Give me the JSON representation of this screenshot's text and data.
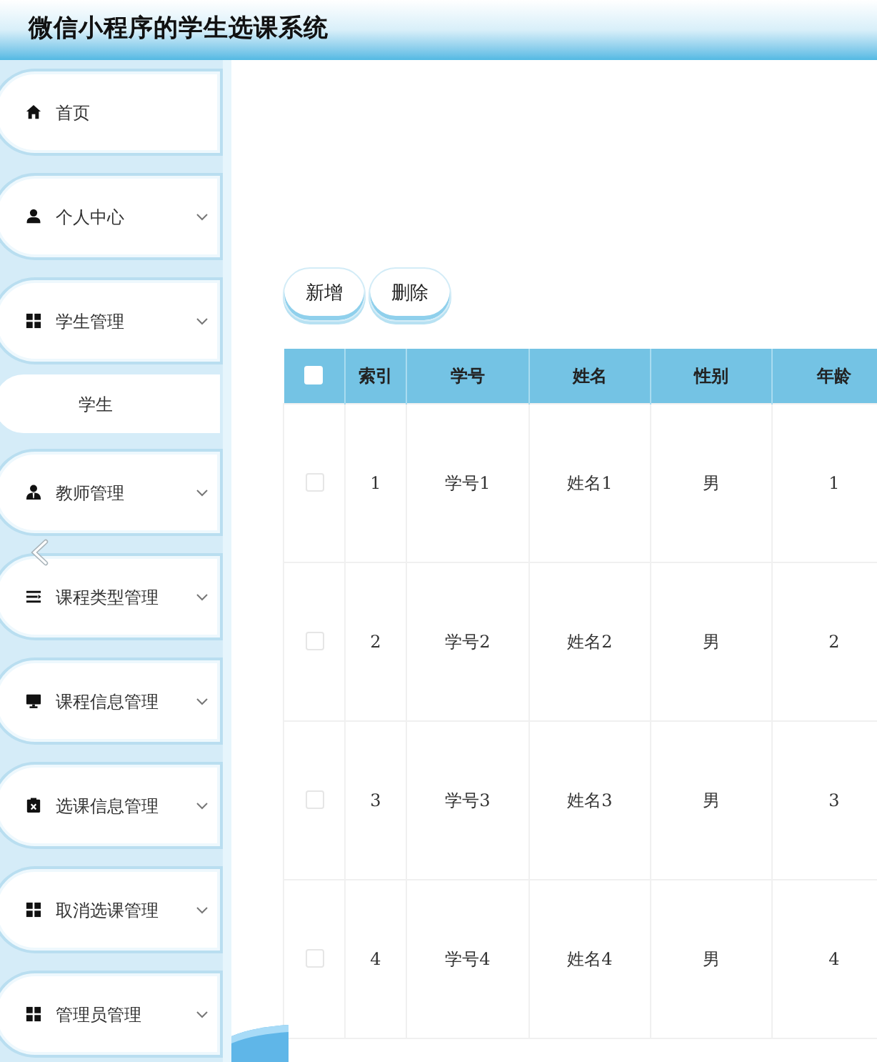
{
  "header": {
    "title": "微信小程序的学生选课系统"
  },
  "sidebar": {
    "items": [
      {
        "label": "首页",
        "kind": "link"
      },
      {
        "label": "个人中心",
        "kind": "group"
      },
      {
        "label": "学生管理",
        "kind": "group",
        "children": [
          {
            "label": "学生"
          }
        ]
      },
      {
        "label": "教师管理",
        "kind": "group"
      },
      {
        "label": "课程类型管理",
        "kind": "group"
      },
      {
        "label": "课程信息管理",
        "kind": "group"
      },
      {
        "label": "选课信息管理",
        "kind": "group"
      },
      {
        "label": "取消选课管理",
        "kind": "group"
      },
      {
        "label": "管理员管理",
        "kind": "group"
      }
    ]
  },
  "toolbar": {
    "buttons": [
      "新增",
      "删除"
    ]
  },
  "table": {
    "select_all": {
      "checked": false
    },
    "columns": [
      "索引",
      "学号",
      "姓名",
      "性别",
      "年龄"
    ],
    "rows": [
      {
        "checked": false,
        "cells": [
          "1",
          "学号1",
          "姓名1",
          "男",
          "1"
        ]
      },
      {
        "checked": false,
        "cells": [
          "2",
          "学号2",
          "姓名2",
          "男",
          "2"
        ]
      },
      {
        "checked": false,
        "cells": [
          "3",
          "学号3",
          "姓名3",
          "男",
          "3"
        ]
      },
      {
        "checked": false,
        "cells": [
          "4",
          "学号4",
          "姓名4",
          "男",
          "4"
        ]
      }
    ]
  }
}
